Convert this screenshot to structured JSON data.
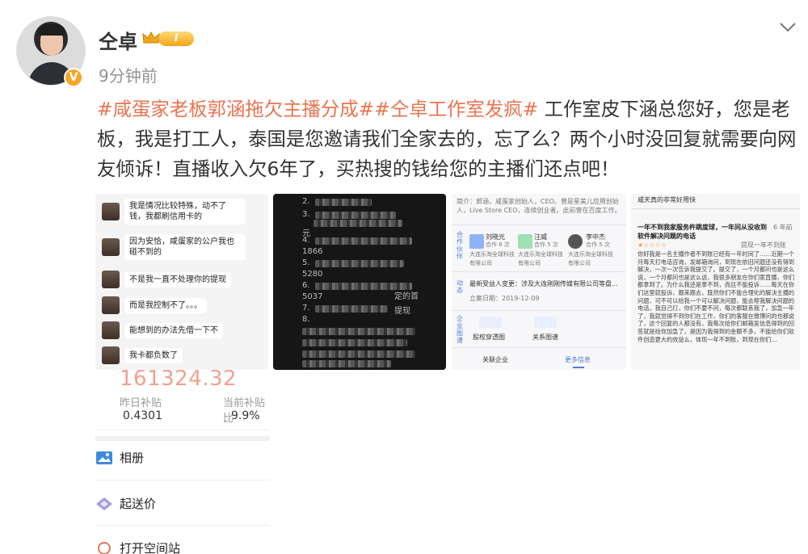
{
  "post": {
    "username": "仝卓",
    "level_badge": "I",
    "time": "9分钟前",
    "verified_badge": "V",
    "topics": [
      "#咸蛋家老板郭涵拖欠主播分成#",
      "#仝卓工作室发疯#"
    ],
    "text": " 工作室皮下涵总您好，您是老板，我是打工人，泰国是您邀请我们全家去的，忘了么？两个小时没回复就需要向网友倾诉！直播收入欠6年了，买热搜的钱给您的主播们还点吧！"
  },
  "icons": {
    "avatar": "profile-photo",
    "crown": "crown-icon",
    "chevron": "chevron-down-icon",
    "album": "album-icon",
    "price": "diamond-icon"
  },
  "images": {
    "chat": {
      "messages": [
        "我是情况比较特殊，动不了钱，我都刷信用卡的",
        "因为安恰，咸蛋家的公户我也碰不到的",
        "不是我一直不处理你的提现",
        "而是我控制不了。。。",
        "能想到的办法先借一下不",
        "我卡都负数了"
      ]
    },
    "dark_list": {
      "visible_fragments": [
        "2.",
        "3.",
        "元",
        "4.",
        "1866",
        "5.",
        "5280",
        "6.",
        "5037",
        "7.",
        "定的首",
        "提现",
        "8."
      ]
    },
    "company": {
      "intro": "简介：郭涵，咸蛋家创始人，CEO。曾是星美儿应用创始人，Live Store CEO，连续创业者。此前曾在百度工作。",
      "people": [
        {
          "name": "刘晓光",
          "role": "合作 6 次",
          "company": "大连乐淘全球科技有限公司"
        },
        {
          "name": "汪威",
          "role": "合作 5 次",
          "company": "大连乐淘全球科技有限公司"
        },
        {
          "name": "李中杰",
          "role": "合作 5 次",
          "company": "大连乐淘全球科技有限公司"
        }
      ],
      "change": "最新受益人变更：涉及大连刚刚传媒有限公司等盘...",
      "change_date": "立案日期：2019-12-09",
      "side_labels": [
        "合作伙伴",
        "动态",
        "企业图谱"
      ],
      "graph_items": [
        "股权穿透图",
        "关系图谱"
      ],
      "tabs": [
        "关联企业",
        "更多信息"
      ]
    },
    "review": {
      "top_line": "咸天真的非常好用快",
      "title": "一年不到我家服务杵跳度球，一年间从没收到软件解决问题的电话",
      "date": "6 年前",
      "stars": "★☆☆☆☆",
      "helpful": "提现一年不到账",
      "body": "你好我是一名主播作者不到账已经有一年时间了……近期一个月每天打电话咨询，发邮箱询问，到现在依旧问题还没有得到解决，一次一次告诉我提交了。提交了，一个月都问也是这么说，一个月都问也是这么说，我很多朋友在你们家直播，你们都拿到了。为什么我还是拿不到，而且不能投诉……每天在你们这里就投诉，跟来跟去，既然你们不能合理化的解决主播的问题，可不可以给我一个可以解决问题，能去帮我解决问题的电话，我自己打，你们不要不问，每次都联系我了，加急一年了，我就觉得不到你们在工作，你们的客服在微博问的也都说了，这个回复的人都没有，我每次给你们邮箱发信息得到的回答就是给你加急了，是因为我得到的金额不多，不能给你们软件创造更大的效益么，体现一年不到账，到现在你们…"
    }
  },
  "stats": {
    "total": "161324.32",
    "labels": [
      "昨日补贴",
      "当前补贴比"
    ],
    "values": [
      "0.4301",
      "9.9%"
    ],
    "menu": [
      "相册",
      "起送价",
      "打开空间站"
    ]
  }
}
